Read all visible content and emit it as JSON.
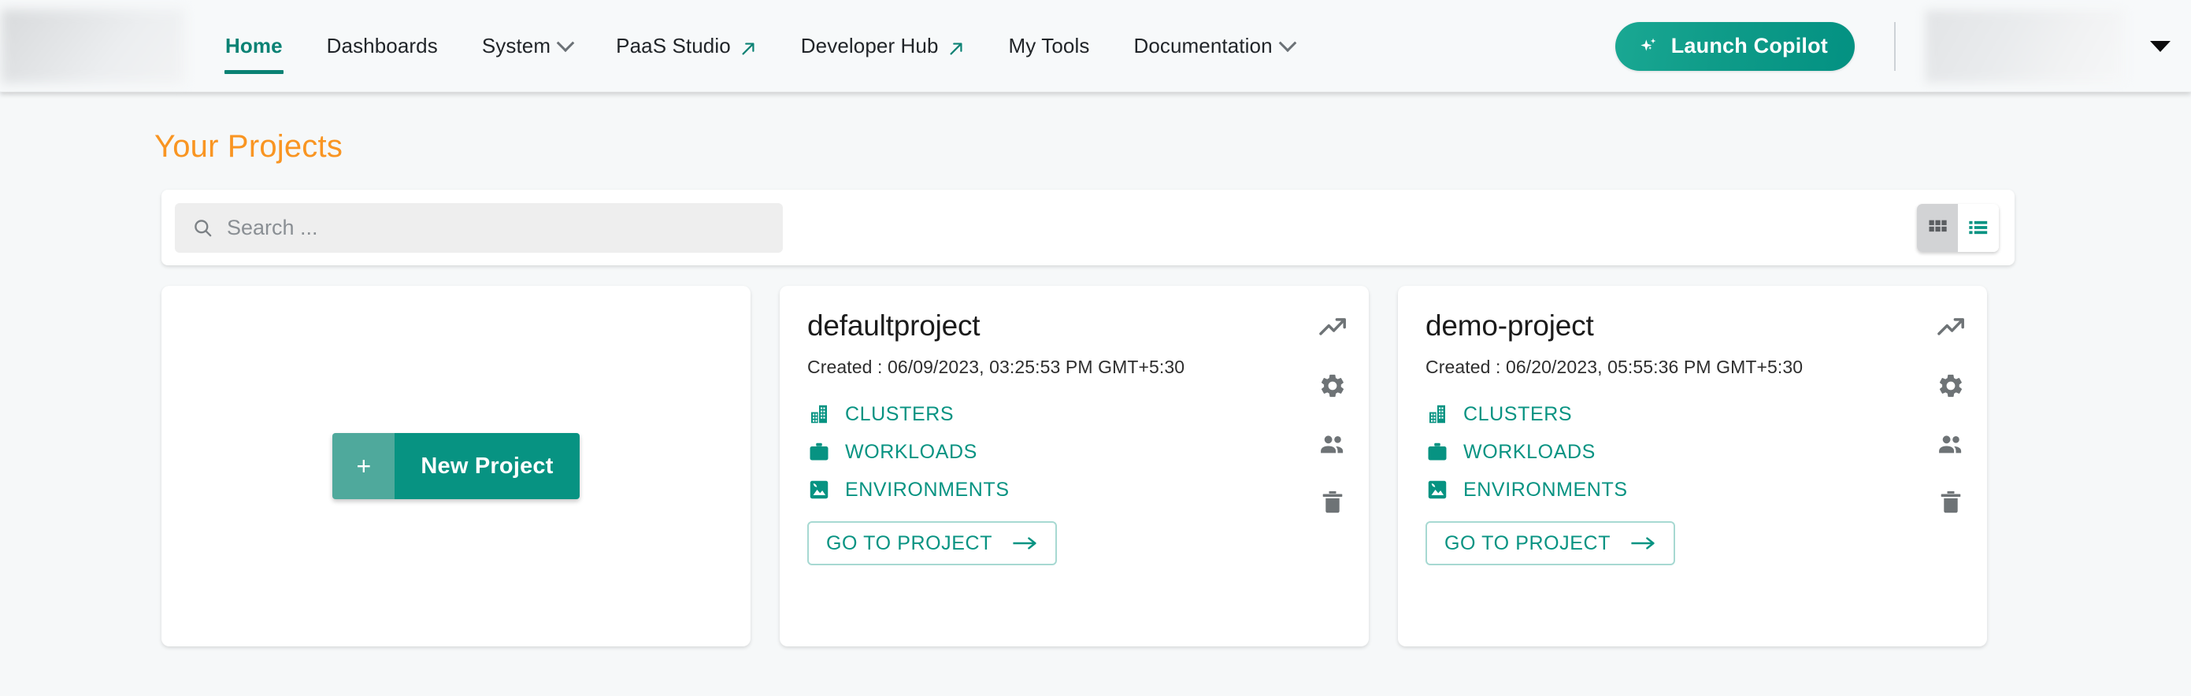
{
  "header": {
    "logo": "company-logo-redacted",
    "nav": [
      {
        "label": "Home",
        "active": true,
        "trailing": "none"
      },
      {
        "label": "Dashboards",
        "active": false,
        "trailing": "none"
      },
      {
        "label": "System",
        "active": false,
        "trailing": "chevron-down"
      },
      {
        "label": "PaaS Studio",
        "active": false,
        "trailing": "external-link"
      },
      {
        "label": "Developer Hub",
        "active": false,
        "trailing": "external-link"
      },
      {
        "label": "My Tools",
        "active": false,
        "trailing": "none"
      },
      {
        "label": "Documentation",
        "active": false,
        "trailing": "chevron-down"
      }
    ],
    "copilot_label": "Launch Copilot",
    "user_name": "user-name-redacted"
  },
  "main": {
    "page_title": "Your Projects",
    "search": {
      "placeholder": "Search ...",
      "value": ""
    },
    "view_toggle": {
      "grid_label": "Grid view",
      "list_label": "List view",
      "active": "grid"
    },
    "new_project": {
      "plus": "+",
      "label": "New Project"
    },
    "link_labels": {
      "clusters": "CLUSTERS",
      "workloads": "WORKLOADS",
      "environments": "ENVIRONMENTS"
    },
    "goto_label": "GO TO PROJECT",
    "created_prefix": "Created : ",
    "projects": [
      {
        "name": "defaultproject",
        "created": "Created :  06/09/2023, 03:25:53 PM GMT+5:30"
      },
      {
        "name": "demo-project",
        "created": "Created :  06/20/2023, 05:55:36 PM GMT+5:30"
      }
    ]
  },
  "colors": {
    "teal": "#079382",
    "teal_dark": "#0b8274",
    "orange": "#f99522",
    "page_bg": "#f6f8f9",
    "header_bg": "#f7f9fa",
    "card_bg": "#ffffff",
    "icon_gray": "#6e7376",
    "search_bg": "#eeeeee"
  }
}
